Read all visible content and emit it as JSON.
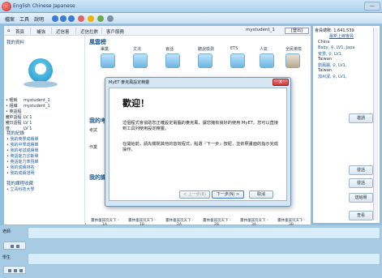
{
  "window": {
    "title": "English Chinese Japanese",
    "close_label": "—"
  },
  "menu": {
    "items": [
      "檔案",
      "工具",
      "說明"
    ]
  },
  "nav": {
    "links": [
      "首頁",
      "補強",
      "近信害",
      "近信拉數",
      "客戶服務"
    ],
    "username": "mystudent_1",
    "logout_label": "[登出]"
  },
  "profile": {
    "title": "我的資料",
    "fields": [
      {
        "key": "• 暱稱",
        "value": "mystudent_1"
      },
      {
        "key": "• 組織",
        "value": "mystudent_1"
      },
      {
        "key": "• 英語程度:",
        "value": "LV 1"
      },
      {
        "key": "• 中語程度:",
        "value": "LV 1"
      },
      {
        "key": "• 日語程度:",
        "value": "LV 1"
      }
    ]
  },
  "records": {
    "title": "我的紀錄",
    "items": [
      "• 我的英學成績單",
      "• 我的中學成績單",
      "• 我的考試成績單",
      "• 英語能力診斷單",
      "• 英語能力表現單",
      "• 我的成績排名",
      "• 我的成績證明"
    ]
  },
  "favorites": {
    "title": "我的課程收藏",
    "items": [
      "• 立青科技大學"
    ]
  },
  "main": {
    "style_title": "風雲榜",
    "categories": [
      "畢業",
      "文法",
      "會話",
      "聽說檢測",
      "ETS",
      "人氣",
      "全民英檢"
    ],
    "test_title": "我的考試",
    "rows": [
      "考試",
      "作業"
    ],
    "course_title": "我的課程",
    "bottom_items": [
      {
        "name": "畫林童謠玩天下 -",
        "level": "1A"
      },
      {
        "name": "畫林童謠玩天下 -",
        "level": "1B"
      },
      {
        "name": "畫林童謠玩天下 -",
        "level": "2A"
      },
      {
        "name": "畫林童謠玩天下 -",
        "level": "2B"
      },
      {
        "name": "畫林童謠玩天下 -",
        "level": "3A"
      },
      {
        "name": "畫林童謠玩天下 -",
        "level": "3B"
      }
    ]
  },
  "sidebar": {
    "head": "會員總數: 1,641,539",
    "sub": "最新上線會員",
    "buddies": [
      {
        "text": "China",
        "blue": false
      },
      {
        "text": "Baby, ♀, LV1, Japa",
        "blue": true
      },
      {
        "text": "安慧, ♀, LV1,",
        "blue": true
      },
      {
        "text": "Taiwan",
        "blue": false
      },
      {
        "text": "劉鳳麗, ♀, LV1,",
        "blue": true
      },
      {
        "text": "Taiwan",
        "blue": false
      },
      {
        "text": "加州潔, ♀, LV1,",
        "blue": true
      }
    ],
    "buttons": [
      "邀請",
      "發話",
      "發話",
      "送給朋",
      "查看"
    ]
  },
  "bottom": {
    "teacher_label": "老師",
    "student_label": "學生"
  },
  "dialog": {
    "title": "MyET 麥克風設定精靈",
    "close_label": "X",
    "heading": "歡迎！",
    "paragraph1": "這個程式會協助您正確設定電腦的麥克風，讓您擁有良好的使用 MyET。您可以直接到工具列使用設定精靈。",
    "paragraph2": "在開始前，請先關閉其他的音效程式，點選『下一步』按鈕，並依照畫面的指示完成操作。",
    "back_label": "< 上一步(B)",
    "next_label": "下一步(N) >",
    "cancel_label": "取消"
  }
}
